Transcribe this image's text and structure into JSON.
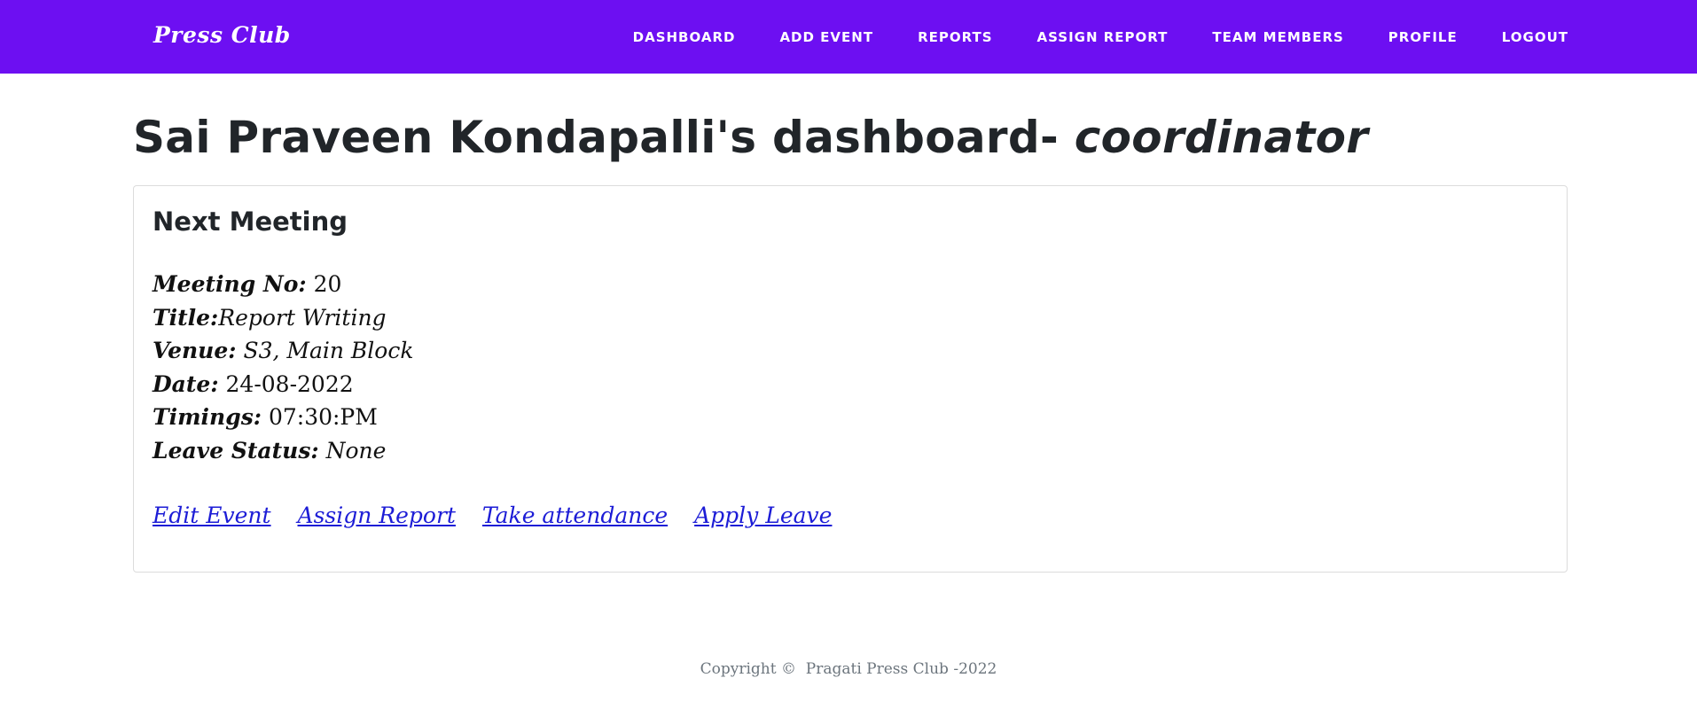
{
  "navbar": {
    "brand": "Press Club",
    "links": [
      "DASHBOARD",
      "ADD EVENT",
      "REPORTS",
      "ASSIGN REPORT",
      "TEAM MEMBERS",
      "PROFILE",
      "LOGOUT"
    ],
    "background_color": "#6d0ff2"
  },
  "page": {
    "title_name": "Sai Praveen Kondapalli's dashboard- ",
    "title_role": "coordinator"
  },
  "card": {
    "heading": "Next Meeting",
    "details": {
      "meeting_no_label": "Meeting No:",
      "meeting_no_value": " 20",
      "title_label": "Title:",
      "title_value": "Report Writing",
      "venue_label": "Venue:",
      "venue_value": " S3, Main Block",
      "date_label": "Date:",
      "date_value": " 24-08-2022",
      "timings_label": "Timings:",
      "timings_value": " 07:30:PM",
      "leave_label": "Leave Status:",
      "leave_value": " None"
    },
    "actions": [
      "Edit Event",
      "Assign Report",
      "Take attendance",
      "Apply Leave"
    ]
  },
  "footer": {
    "text": "Copyright ©  Pragati Press Club -2022"
  }
}
